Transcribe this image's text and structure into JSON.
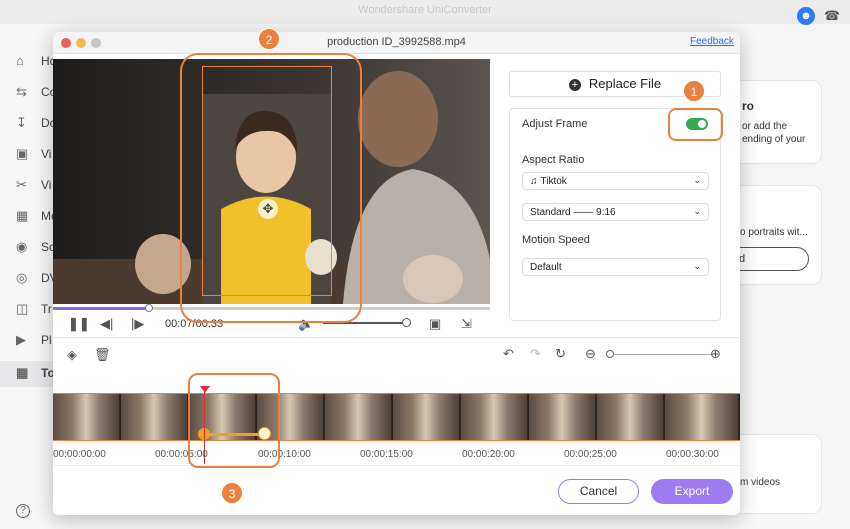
{
  "app": {
    "title": "Wondershare UniConverter"
  },
  "sidebar": {
    "items": [
      {
        "label": "Ho",
        "icon": "home-icon"
      },
      {
        "label": "Co",
        "icon": "convert-icon"
      },
      {
        "label": "Do",
        "icon": "download-icon"
      },
      {
        "label": "Vi",
        "icon": "video-icon"
      },
      {
        "label": "Vi",
        "icon": "scissors-icon"
      },
      {
        "label": "Me",
        "icon": "merge-icon"
      },
      {
        "label": "Sc",
        "icon": "screen-icon"
      },
      {
        "label": "DV",
        "icon": "dvd-icon"
      },
      {
        "label": "Tr",
        "icon": "transfer-icon"
      },
      {
        "label": "Pl",
        "icon": "player-icon"
      },
      {
        "label": "To",
        "icon": "grid-icon"
      }
    ],
    "help": "?"
  },
  "bg_cards": {
    "card1": {
      "title": "ro",
      "line1": "or add the",
      "line2": "ending of your"
    },
    "card2": {
      "line1": "o portraits wit..."
    },
    "card2_button": "d",
    "card3": {
      "line1": "m videos"
    }
  },
  "dialog": {
    "title": "production ID_3992588.mp4",
    "feedback": "Feedback",
    "time": "00:07/00:33",
    "progress_fraction": 0.22,
    "volume_fraction": 0.94,
    "replace_file": "Replace File",
    "adjust_frame": "Adjust Frame",
    "adjust_frame_on": true,
    "aspect_ratio_label": "Aspect Ratio",
    "aspect_ratio_platform": "Tiktok",
    "aspect_ratio_value": "Standard —— 9:16",
    "motion_speed_label": "Motion Speed",
    "motion_speed_value": "Default",
    "zoom_fraction": 0.0,
    "timeline_ticks": [
      "00:00:00:00",
      "00:00:05:00",
      "00:00:10:00",
      "00:00:15:00",
      "00:00:20:00",
      "00:00:25:00",
      "00:00:30:00"
    ],
    "cancel": "Cancel",
    "export": "Export"
  },
  "callouts": {
    "one": "1",
    "two": "2",
    "three": "3"
  },
  "colors": {
    "accent": "#9f7cf2",
    "highlight": "#e8823e",
    "toggle_on": "#34a853",
    "playhead": "#d9302c"
  }
}
